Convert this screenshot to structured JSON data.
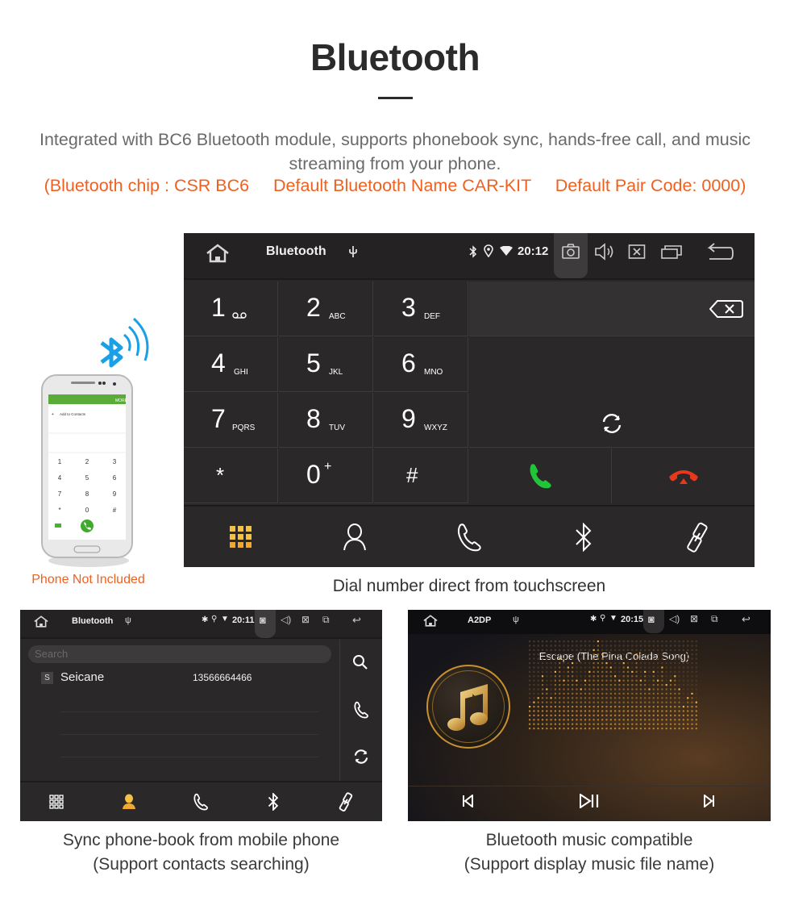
{
  "header": {
    "title": "Bluetooth",
    "description": "Integrated with BC6 Bluetooth module, supports phonebook sync, hands-free call, and music streaming from your phone.",
    "specs": {
      "chip": "(Bluetooth chip : CSR BC6",
      "name": "Default Bluetooth Name CAR-KIT",
      "code": "Default Pair Code: 0000)"
    }
  },
  "colors": {
    "accent_orange": "#f0601e",
    "call_green": "#22c43a",
    "hangup_red": "#e8381c",
    "active_tab_yellow": "#f5c142",
    "bluetooth_blue": "#1aa0e6"
  },
  "phone_illustration": {
    "caption": "Phone Not Included",
    "menu_label": "MORE",
    "add_contacts": "Add to Contacts",
    "keys": [
      "1",
      "2",
      "3",
      "4",
      "5",
      "6",
      "7",
      "8",
      "9",
      "*",
      "0",
      "#"
    ]
  },
  "dialer_screen": {
    "status": {
      "home_icon": "home-icon",
      "title": "Bluetooth",
      "usb_icon": "usb-icon",
      "time": "20:12"
    },
    "keys": [
      {
        "num": "1",
        "sub": "voicemail"
      },
      {
        "num": "2",
        "sub": "ABC"
      },
      {
        "num": "3",
        "sub": "DEF"
      },
      {
        "num": "4",
        "sub": "GHI"
      },
      {
        "num": "5",
        "sub": "JKL"
      },
      {
        "num": "6",
        "sub": "MNO"
      },
      {
        "num": "7",
        "sub": "PQRS"
      },
      {
        "num": "8",
        "sub": "TUV"
      },
      {
        "num": "9",
        "sub": "WXYZ"
      },
      {
        "num": "*",
        "sub": ""
      },
      {
        "num": "0",
        "sub": "+"
      },
      {
        "num": "#",
        "sub": ""
      }
    ],
    "display_value": "",
    "tabs": [
      "keypad",
      "contacts",
      "call-log",
      "bluetooth",
      "pairing-link"
    ],
    "active_tab": "keypad",
    "caption": "Dial number direct from touchscreen"
  },
  "contacts_screen": {
    "status": {
      "title": "Bluetooth",
      "time": "20:11"
    },
    "search_placeholder": "Search",
    "contacts": [
      {
        "initial": "S",
        "name": "Seicane",
        "number": "13566664466"
      }
    ],
    "active_tab": "contacts",
    "caption_line1": "Sync phone-book from mobile phone",
    "caption_line2": "(Support contacts searching)"
  },
  "music_screen": {
    "status": {
      "title": "A2DP",
      "time": "20:15"
    },
    "song_title": "Escape (The Pina Colada Song)",
    "caption_line1": "Bluetooth music compatible",
    "caption_line2": "(Support display music file name)"
  }
}
